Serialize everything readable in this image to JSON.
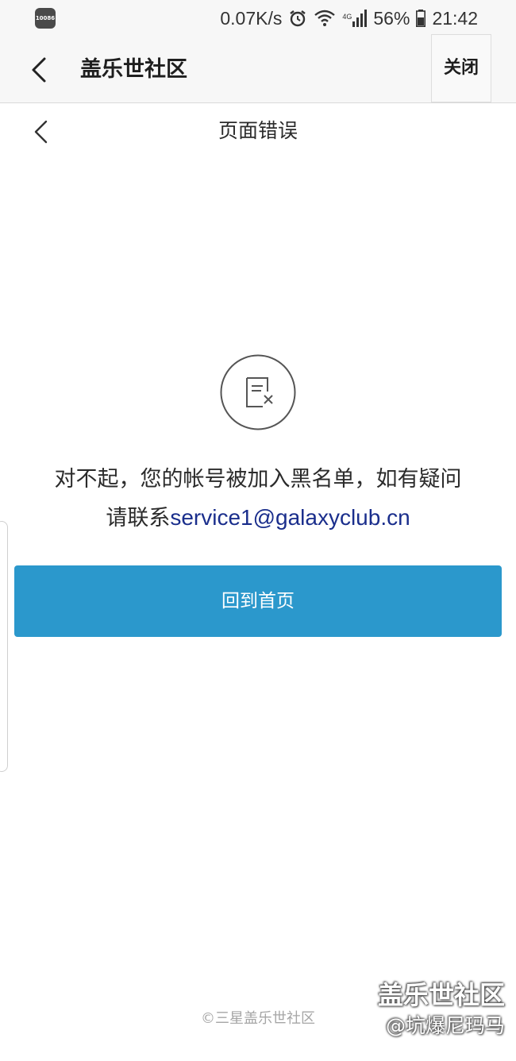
{
  "status_bar": {
    "carrier_label": "10086",
    "network_speed": "0.07K/s",
    "signal_label": "4G",
    "battery": "56%",
    "time": "21:42"
  },
  "app_header": {
    "title": "盖乐世社区",
    "close_label": "关闭"
  },
  "page_header": {
    "title": "页面错误"
  },
  "error": {
    "line1": "对不起，您的帐号被加入黑名单，如有疑问",
    "line2_prefix": "请联系",
    "email": "service1@galaxyclub.cn",
    "home_button_label": "回到首页"
  },
  "footer": {
    "copyright": "©三星盖乐世社区"
  },
  "watermark": {
    "title": "盖乐世社区",
    "author": "@坑爆尼玛马"
  },
  "colors": {
    "primary_button": "#2b98cc",
    "link": "#1a2e8c",
    "header_bg": "#f7f7f7"
  }
}
